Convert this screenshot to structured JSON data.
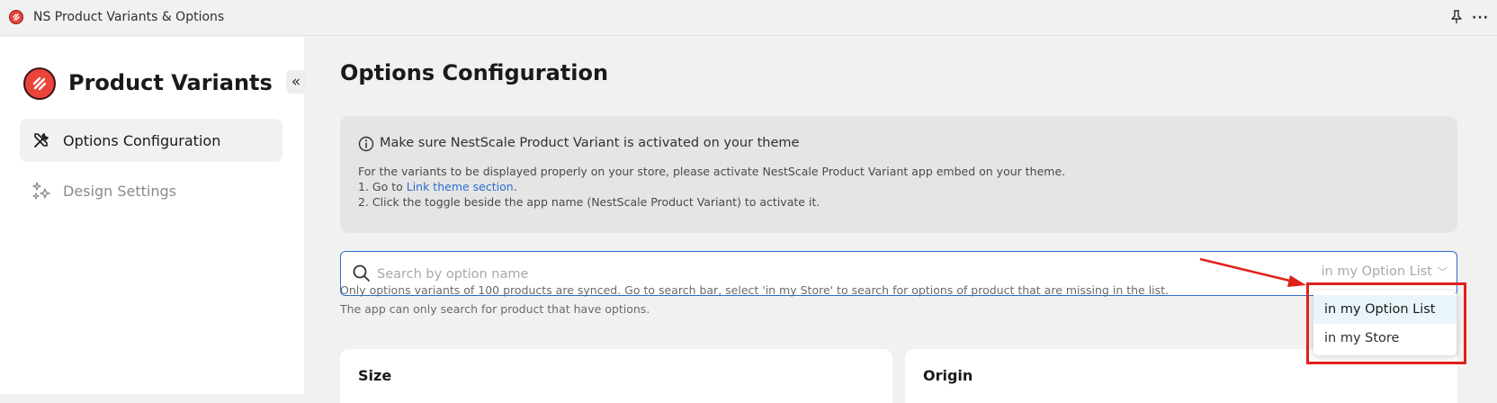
{
  "window": {
    "title": "NS Product Variants & Options"
  },
  "sidebar": {
    "brand": "Product Variants",
    "collapse_label": "«",
    "items": [
      {
        "label": "Options Configuration",
        "icon": "tools-icon",
        "active": true
      },
      {
        "label": "Design Settings",
        "icon": "sparkles-icon",
        "active": false
      }
    ]
  },
  "main": {
    "title": "Options Configuration",
    "banner": {
      "title": "Make sure NestScale Product Variant is activated on your theme",
      "line1": "For the variants to be displayed properly on your store, please activate NestScale Product Variant app embed on your theme.",
      "line2_prefix": "1. Go to ",
      "line2_link": "Link theme section",
      "line2_suffix": ".",
      "line3": "2. Click the toggle beside the app name (NestScale Product Variant) to activate it."
    },
    "search": {
      "placeholder": "Search by option name",
      "scope_value": "in my Option List",
      "scope_chevron": "﹀"
    },
    "hints": [
      "Only options variants of 100 products are synced. Go to search bar, select 'in my Store' to search for options of product that are missing in the list.",
      "The app can only search for product that have options."
    ],
    "cards": [
      {
        "title": "Size"
      },
      {
        "title": "Origin"
      }
    ]
  },
  "dropdown": {
    "options": [
      {
        "label": "in my Option List",
        "selected": true
      },
      {
        "label": "in my Store",
        "selected": false
      }
    ]
  },
  "colors": {
    "accent": "#2c6ecb",
    "brand": "#e8443a",
    "annotation": "#e2201a"
  }
}
